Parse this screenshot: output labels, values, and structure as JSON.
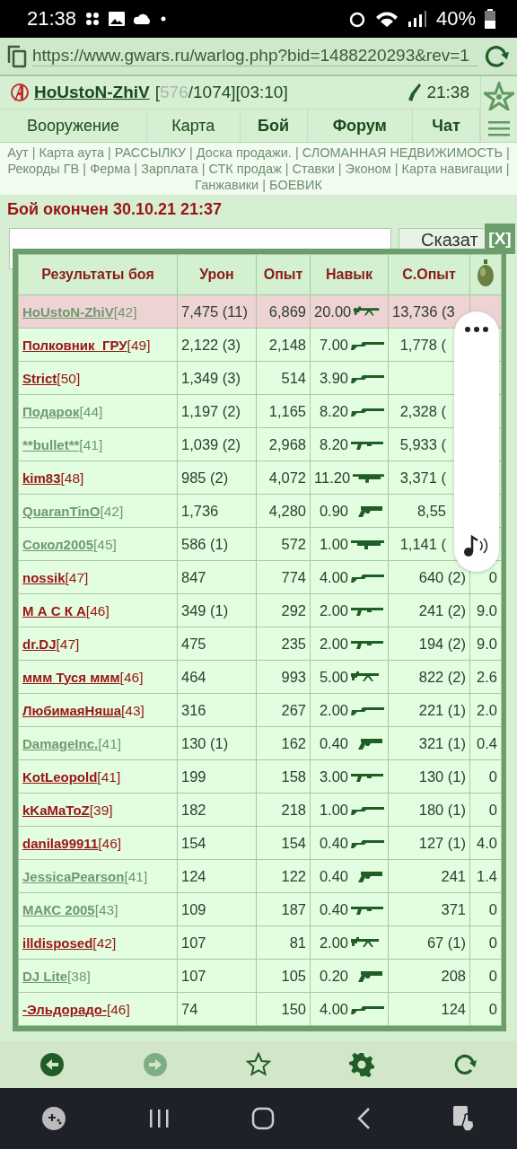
{
  "status_bar": {
    "time": "21:38",
    "battery": "40%"
  },
  "address_bar": {
    "url": "https://www.gwars.ru/warlog.php?bid=1488220293&rev=1"
  },
  "game_header": {
    "player": "HoUstoN-ZhiV",
    "hp_open": "[",
    "hp": "576",
    "hp_rest": "/1074][03:10]",
    "clock": "21:38"
  },
  "nav_tabs": [
    {
      "label": "Вооружение",
      "bold": false
    },
    {
      "label": "Карта",
      "bold": false
    },
    {
      "label": "Бой",
      "bold": true
    },
    {
      "label": "Форум",
      "bold": true
    },
    {
      "label": "Чат",
      "bold": true
    }
  ],
  "links": {
    "separator": "|",
    "items": [
      "Аут",
      "Карта аута",
      "РАССЫЛКУ",
      "Доска продажи.",
      "СЛОМАННАЯ НЕДВИЖИМОСТЬ",
      "Рекорды ГВ",
      "Ферма",
      "Зарплата",
      "СТК продаж",
      "Ставки",
      "Эконом",
      "Карта навигации",
      "Ганжавики",
      "БОЕВИК"
    ]
  },
  "battle_title": "Бой окончен 30.10.21 21:37",
  "say_button": "Сказат",
  "results": {
    "close": "[X]",
    "columns": [
      "Результаты боя",
      "Урон",
      "Опыт",
      "Навык",
      "С.Опыт"
    ],
    "rows": [
      {
        "name": "HoUstoN-ZhiV",
        "level": "[42]",
        "color": "#6f9a6f",
        "highlighted": true,
        "damage": "7,475 (11)",
        "xp": "6,869",
        "skill": "20.00",
        "weapon": {
          "kind": "machinegun"
        },
        "total_xp": "13,736 (3"
      },
      {
        "name": "Полковник_ГРУ",
        "level": "[49]",
        "color": "#9b1414",
        "highlighted": false,
        "damage": "2,122 (3)",
        "xp": "2,148",
        "skill": "7.00",
        "weapon": {
          "kind": "shotgun"
        },
        "total_xp": "1,778 ("
      },
      {
        "name": "Strict",
        "level": "[50]",
        "color": "#9b1414",
        "highlighted": false,
        "damage": "1,349 (3)",
        "xp": "514",
        "skill": "3.90",
        "weapon": {
          "kind": "shotgun"
        }
      },
      {
        "name": "Подарок",
        "level": "[44]",
        "color": "#6f9a6f",
        "highlighted": false,
        "damage": "1,197 (2)",
        "xp": "1,165",
        "skill": "8.20",
        "weapon": {
          "kind": "shotgun"
        },
        "total_xp": "2,328 ("
      },
      {
        "name": "**bullet**",
        "level": "[41]",
        "color": "#6f9a6f",
        "highlighted": false,
        "damage": "1,039 (2)",
        "xp": "2,968",
        "skill": "8.20",
        "weapon": {
          "kind": "smg"
        },
        "total_xp": "5,933 ("
      },
      {
        "name": "kim83",
        "level": "[48]",
        "color": "#9b1414",
        "highlighted": false,
        "damage": "985 (2)",
        "xp": "4,072",
        "skill": "11.20",
        "weapon": {
          "kind": "launcher"
        },
        "total_xp": "3,371 ("
      },
      {
        "name": "QuaranTinO",
        "level": "[42]",
        "color": "#6f9a6f",
        "highlighted": false,
        "damage": "1,736",
        "xp": "4,280",
        "skill": "0.90",
        "weapon": {
          "kind": "pistol"
        },
        "total_xp": "8,55"
      },
      {
        "name": "Сокол2005",
        "level": "[45]",
        "color": "#6f9a6f",
        "highlighted": false,
        "damage": "586 (1)",
        "xp": "572",
        "skill": "1.00",
        "weapon": {
          "kind": "launcher"
        },
        "total_xp": "1,141 ("
      },
      {
        "name": "nossik",
        "level": "[47]",
        "color": "#9b1414",
        "highlighted": false,
        "damage": "847",
        "xp": "774",
        "skill": "4.00",
        "weapon": {
          "kind": "shotgun"
        },
        "total_xp": "640 (2)",
        "column_6": "0"
      },
      {
        "name": "М А С К А",
        "level": "[46]",
        "color": "#9b1414",
        "highlighted": false,
        "damage": "349 (1)",
        "xp": "292",
        "skill": "2.00",
        "weapon": {
          "kind": "smg"
        },
        "total_xp": "241 (2)",
        "column_6": "9.0"
      },
      {
        "name": "dr.DJ",
        "level": "[47]",
        "color": "#9b1414",
        "highlighted": false,
        "damage": "475",
        "xp": "235",
        "skill": "2.00",
        "weapon": {
          "kind": "smg"
        },
        "total_xp": "194 (2)",
        "column_6": "9.0"
      },
      {
        "name": "ммм Туся ммм",
        "level": "[46]",
        "color": "#9b1414",
        "highlighted": false,
        "damage": "464",
        "xp": "993",
        "skill": "5.00",
        "weapon": {
          "kind": "machinegun"
        },
        "total_xp": "822 (2)",
        "column_6": "2.6"
      },
      {
        "name": "ЛюбимаяНяша",
        "level": "[43]",
        "color": "#9b1414",
        "highlighted": false,
        "damage": "316",
        "xp": "267",
        "skill": "2.00",
        "weapon": {
          "kind": "shotgun"
        },
        "total_xp": "221 (1)",
        "column_6": "2.0"
      },
      {
        "name": "DamageInc.",
        "level": "[41]",
        "color": "#6f9a6f",
        "highlighted": false,
        "damage": "130 (1)",
        "xp": "162",
        "skill": "0.40",
        "weapon": {
          "kind": "pistol"
        },
        "total_xp": "321 (1)",
        "column_6": "0.4"
      },
      {
        "name": "KotLeopold",
        "level": "[41]",
        "color": "#9b1414",
        "highlighted": false,
        "damage": "199",
        "xp": "158",
        "skill": "3.00",
        "weapon": {
          "kind": "smg"
        },
        "total_xp": "130 (1)",
        "column_6": "0"
      },
      {
        "name": "kKaMaToZ",
        "level": "[39]",
        "color": "#9b1414",
        "highlighted": false,
        "damage": "182",
        "xp": "218",
        "skill": "1.00",
        "weapon": {
          "kind": "shotgun"
        },
        "total_xp": "180 (1)",
        "column_6": "0"
      },
      {
        "name": "danila99911",
        "level": "[46]",
        "color": "#9b1414",
        "highlighted": false,
        "damage": "154",
        "xp": "154",
        "skill": "0.40",
        "weapon": {
          "kind": "shotgun"
        },
        "total_xp": "127 (1)",
        "column_6": "4.0"
      },
      {
        "name": "JessicaPearson",
        "level": "[41]",
        "color": "#6f9a6f",
        "highlighted": false,
        "damage": "124",
        "xp": "122",
        "skill": "0.40",
        "weapon": {
          "kind": "pistol"
        },
        "total_xp": "241",
        "column_6": "1.4"
      },
      {
        "name": "МАКС 2005",
        "level": "[43]",
        "color": "#6f9a6f",
        "highlighted": false,
        "damage": "109",
        "xp": "187",
        "skill": "0.40",
        "weapon": {
          "kind": "smg"
        },
        "total_xp": "371",
        "column_6": "0"
      },
      {
        "name": "illdisposed",
        "level": "[42]",
        "color": "#9b1414",
        "highlighted": false,
        "damage": "107",
        "xp": "81",
        "skill": "2.00",
        "weapon": {
          "kind": "machinegun"
        },
        "total_xp": "67 (1)",
        "column_6": "0"
      },
      {
        "name": "DJ Lite",
        "level": "[38]",
        "color": "#6f9a6f",
        "highlighted": false,
        "damage": "107",
        "xp": "105",
        "skill": "0.20",
        "weapon": {
          "kind": "pistol"
        },
        "total_xp": "208",
        "column_6": "0"
      },
      {
        "name": "-Эльдорадо-",
        "level": "[46]",
        "color": "#9b1414",
        "highlighted": false,
        "damage": "74",
        "xp": "150",
        "skill": "4.00",
        "weapon": {
          "kind": "shotgun"
        },
        "total_xp": "124",
        "column_6": "0"
      }
    ]
  },
  "bottom_toolbar": [
    {
      "kind": "back",
      "disabled": false
    },
    {
      "kind": "forward",
      "disabled": true
    },
    {
      "kind": "star",
      "disabled": false
    },
    {
      "kind": "settings",
      "disabled": false
    },
    {
      "kind": "reload",
      "disabled": false
    }
  ]
}
